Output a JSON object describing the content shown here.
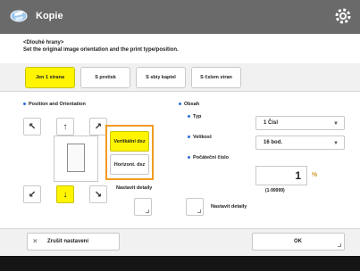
{
  "app": {
    "title": "Kopie",
    "logo_icon": "fan-logo-icon",
    "settings_icon": "gear-icon"
  },
  "instruction": {
    "line1": "<Dlouhé hrany>",
    "line2": "Set the original image orientation and the print type/position."
  },
  "tabs": [
    {
      "label": "Jen 1 strana",
      "active": true
    },
    {
      "label": "S protisk",
      "active": false
    },
    {
      "label": "S sbiy kaptel",
      "active": false
    },
    {
      "label": "S čslem stran",
      "active": false
    }
  ],
  "position": {
    "title": "Position and Orientation",
    "arrows": [
      {
        "glyph": "↖",
        "name": "arrow-up-left-icon",
        "active": false
      },
      {
        "glyph": "↑",
        "name": "arrow-up-icon",
        "active": false
      },
      {
        "glyph": "↗",
        "name": "arrow-up-right-icon",
        "active": false
      },
      {
        "glyph": "↙",
        "name": "arrow-down-left-icon",
        "active": false
      },
      {
        "glyph": "↓",
        "name": "arrow-down-icon",
        "active": true
      },
      {
        "glyph": "↘",
        "name": "arrow-down-right-icon",
        "active": false
      }
    ],
    "orientation": [
      {
        "label": "Vertikální dsz",
        "active": true
      },
      {
        "label": "Horizont. dsz",
        "active": false
      }
    ],
    "detail_label": "Nastavit detaily"
  },
  "text": {
    "title": "Obsah",
    "type_label": "Typ",
    "type_value": "1 Čísl",
    "size_label": "Velikost",
    "size_value": "16 bod.",
    "start_label": "Počáteční číslo",
    "start_value": "1",
    "range": "(1-99999)",
    "detail_label": "Nastavit detaily"
  },
  "buttons": {
    "cancel": "Zrušit nastavení",
    "ok": "OK"
  },
  "colors": {
    "accent": "#fff500",
    "highlight": "#f29b21",
    "titlebar": "#6a6a6a"
  }
}
